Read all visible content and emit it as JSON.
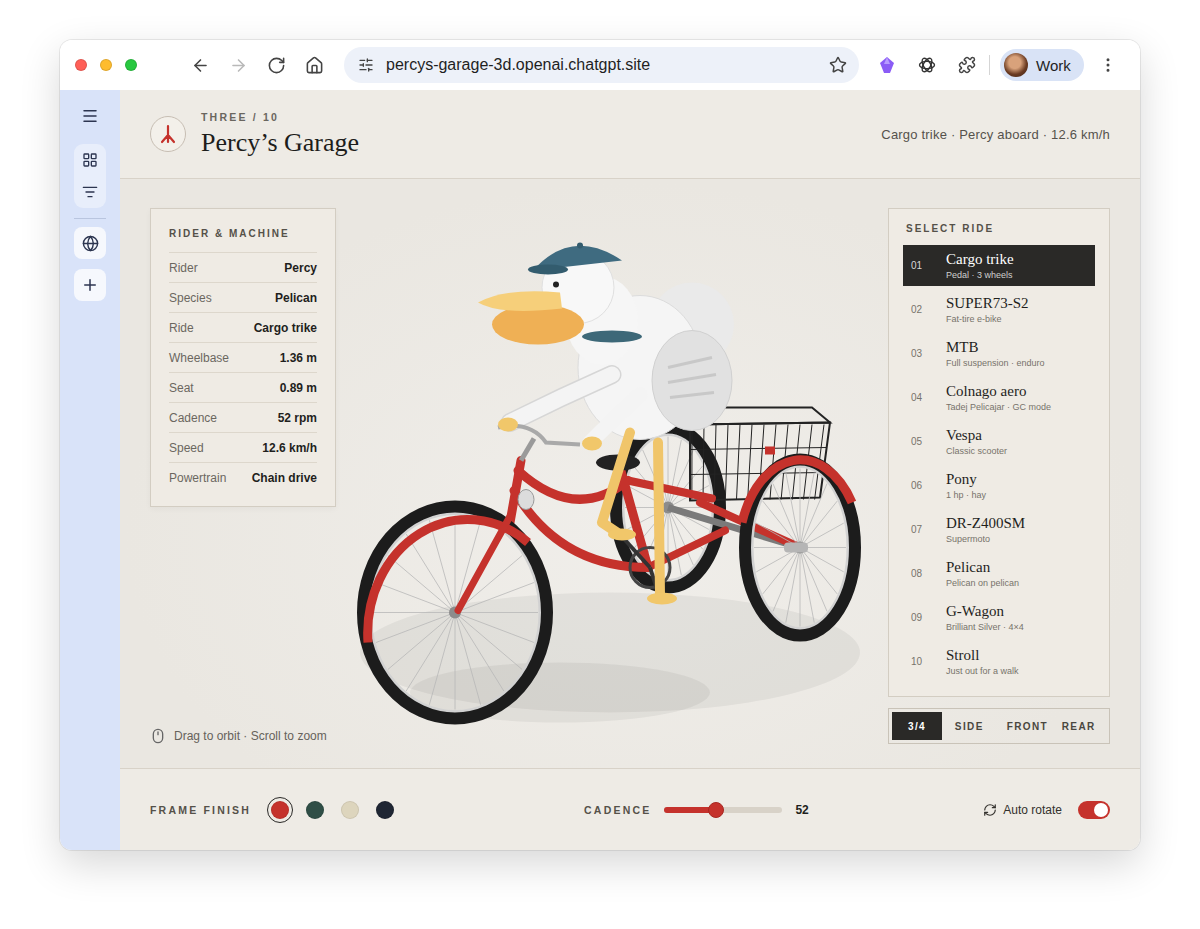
{
  "browser": {
    "url": "percys-garage-3d.openai.chatgpt.site",
    "profile": "Work",
    "bookmarked": false,
    "nav": [
      {
        "kind": "back",
        "disabled": false
      },
      {
        "kind": "forward",
        "disabled": true
      },
      {
        "kind": "reload",
        "disabled": false
      },
      {
        "kind": "home",
        "disabled": false
      }
    ]
  },
  "header": {
    "eyebrow": "THREE / 10",
    "title": "Percy’s Garage",
    "summary": "Cargo trike · Percy aboard · 12.6 km/h"
  },
  "spec_card": {
    "title": "RIDER & MACHINE",
    "rows": [
      {
        "label": "Rider",
        "value": "Percy"
      },
      {
        "label": "Species",
        "value": "Pelican"
      },
      {
        "label": "Ride",
        "value": "Cargo trike"
      },
      {
        "label": "Wheelbase",
        "value": "1.36 m"
      },
      {
        "label": "Seat",
        "value": "0.89 m"
      },
      {
        "label": "Cadence",
        "value": "52 rpm"
      },
      {
        "label": "Speed",
        "value": "12.6 km/h"
      },
      {
        "label": "Powertrain",
        "value": "Chain drive"
      }
    ]
  },
  "hint": "Drag to orbit · Scroll to zoom",
  "ride_list": {
    "title": "SELECT RIDE",
    "items": [
      {
        "number": "01",
        "name": "Cargo trike",
        "detail": "Pedal · 3 wheels",
        "selected": true
      },
      {
        "number": "02",
        "name": "SUPER73-S2",
        "detail": "Fat-tire e-bike",
        "selected": false
      },
      {
        "number": "03",
        "name": "MTB",
        "detail": "Full suspension · enduro",
        "selected": false
      },
      {
        "number": "04",
        "name": "Colnago aero",
        "detail": "Tadej Pelicajar · GC mode",
        "selected": false
      },
      {
        "number": "05",
        "name": "Vespa",
        "detail": "Classic scooter",
        "selected": false
      },
      {
        "number": "06",
        "name": "Pony",
        "detail": "1 hp · hay",
        "selected": false
      },
      {
        "number": "07",
        "name": "DR-Z400SM",
        "detail": "Supermoto",
        "selected": false
      },
      {
        "number": "08",
        "name": "Pelican",
        "detail": "Pelican on pelican",
        "selected": false
      },
      {
        "number": "09",
        "name": "G-Wagon",
        "detail": "Brilliant Silver · 4×4",
        "selected": false
      },
      {
        "number": "10",
        "name": "Stroll",
        "detail": "Just out for a walk",
        "selected": false
      }
    ]
  },
  "views": [
    {
      "label": "3/4",
      "selected": true
    },
    {
      "label": "SIDE",
      "selected": false
    },
    {
      "label": "FRONT",
      "selected": false
    },
    {
      "label": "REAR",
      "selected": false
    }
  ],
  "footer": {
    "finish_label": "FRAME FINISH",
    "swatches": [
      {
        "color": "#c5322c",
        "selected": true
      },
      {
        "color": "#2f4e46",
        "selected": false
      },
      {
        "color": "#ddd5bd",
        "selected": false
      },
      {
        "color": "#1f2633",
        "selected": false
      }
    ],
    "cadence_label": "CADENCE",
    "cadence": {
      "level": 0.44,
      "reading": "52"
    },
    "auto_rotate": {
      "label": "Auto rotate",
      "on": true
    }
  }
}
